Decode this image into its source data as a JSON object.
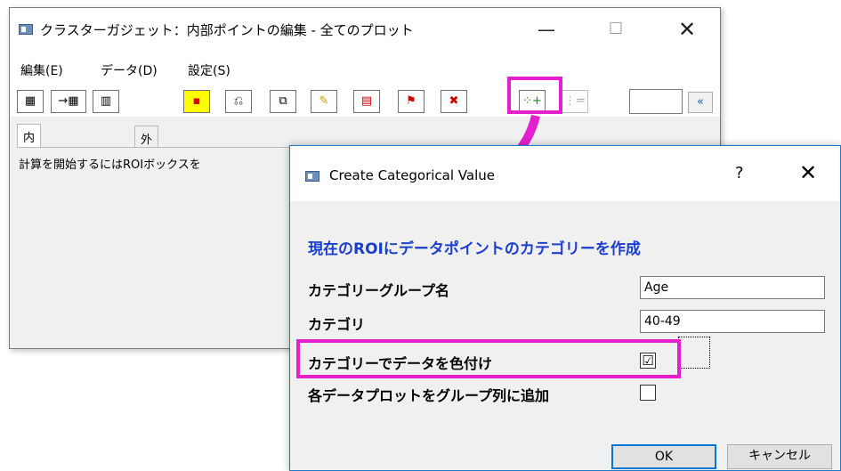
{
  "main_window": {
    "title": "クラスターガジェット：内部ポイントの編集 - 全てのプロット",
    "minimize_label": "—",
    "maximize_label": "☐",
    "close_label": "✕",
    "menu": [
      "編集(E)",
      "データ(D)",
      "設定(S)"
    ],
    "toolbar_buttons": [
      {
        "icon": "import-data-icon",
        "glyph": "▦"
      },
      {
        "icon": "send-to-sheet-icon",
        "glyph": "→▦"
      },
      {
        "icon": "worksheet-icon",
        "glyph": "▥"
      },
      {
        "icon": "marker-icon",
        "glyph": "▪"
      },
      {
        "icon": "undo-icon",
        "glyph": "⎌"
      },
      {
        "icon": "copy-icon",
        "glyph": "⧉"
      },
      {
        "icon": "brush-icon",
        "glyph": "✎"
      },
      {
        "icon": "delete-rows-icon",
        "glyph": "▤"
      },
      {
        "icon": "mask-icon",
        "glyph": "⚑"
      },
      {
        "icon": "clear-mask-icon",
        "glyph": "✖"
      },
      {
        "icon": "create-categorical-value-icon",
        "glyph": "⁘+"
      },
      {
        "icon": "disabled-list-icon",
        "glyph": "⋮="
      }
    ],
    "toolbar_input_value": "",
    "collapse_label": "«",
    "tabs": [
      "内部ポイント",
      "外部ポイント"
    ],
    "panel_text": "計算を開始するにはROIボックスを"
  },
  "dialog": {
    "title": "Create Categorical Value",
    "help_label": "?",
    "close_label": "✕",
    "heading": "現在のROIにデータポイントのカテゴリーを作成",
    "fields": {
      "group_name_label": "カテゴリーグループ名",
      "group_name_value": "Age",
      "category_label": "カテゴリ",
      "category_value": "40-49",
      "color_by_label": "カテゴリーでデータを色付け",
      "color_by_checked": "☑",
      "add_group_label": "各データプロットをグループ列に追加",
      "add_group_checked": ""
    },
    "ok_label": "OK",
    "cancel_label": "キャンセル"
  },
  "colors": {
    "highlight": "#e51fd0",
    "heading_blue": "#1a3fd0",
    "ok_border": "#0078d7"
  }
}
